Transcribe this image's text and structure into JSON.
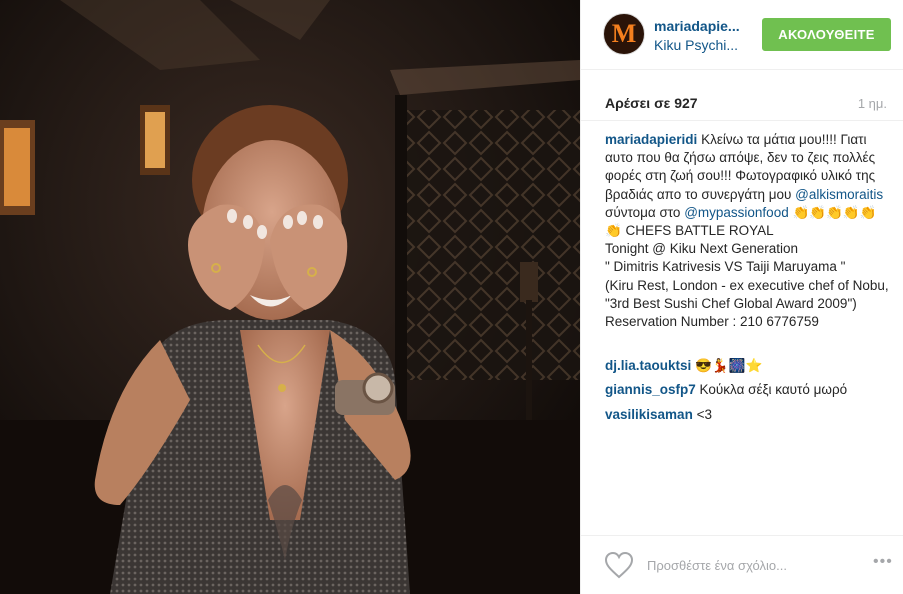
{
  "header": {
    "username": "mariadapie...",
    "location": "Kiku Psychi...",
    "follow_label": "ΑΚΟΛΟΥΘΕΙΤΕ",
    "avatar_letter": "M"
  },
  "stats": {
    "likes": "Αρέσει σε 927",
    "time": "1 ημ."
  },
  "caption": {
    "author": "mariadapieridi",
    "text_1": "Κλείνω τα μάτια μου!!!! Γιατι αυτο που θα ζήσω απόψε, δεν το ζεις πολλές φορές στη ζωή σου!!! Φωτογραφικό υλικό της βραδιάς απο το συνεργάτη μου",
    "mention_1": "@alkismoraitis",
    "text_2": "σύντομα στο",
    "mention_2": "@mypassionfood",
    "text_3": "👏👏👏👏👏👏 CHEFS BATTLE ROYAL",
    "line_4": "Tonight @ Kiku Next Generation",
    "line_5": "\" Dimitris Katrivesis VS Taiji Maruyama \"",
    "line_6": "(Kiru Rest, London - ex executive chef of Nobu, \"3rd Best Sushi Chef Global Award 2009\") Reservation Number : 210 6776759"
  },
  "comments": [
    {
      "author": "dj.lia.taouktsi",
      "text": "😎💃🎆⭐"
    },
    {
      "author": "giannis_osfp7",
      "text": "Κούκλα σέξι καυτό μωρό"
    },
    {
      "author": "vasilikisaman",
      "text": "<3"
    }
  ],
  "footer": {
    "comment_placeholder": "Προσθέστε ένα σχόλιο...",
    "more_label": "•••"
  },
  "colors": {
    "accent_blue": "#125688",
    "follow_green": "#70c050",
    "muted_gray": "#a5a7aa"
  }
}
